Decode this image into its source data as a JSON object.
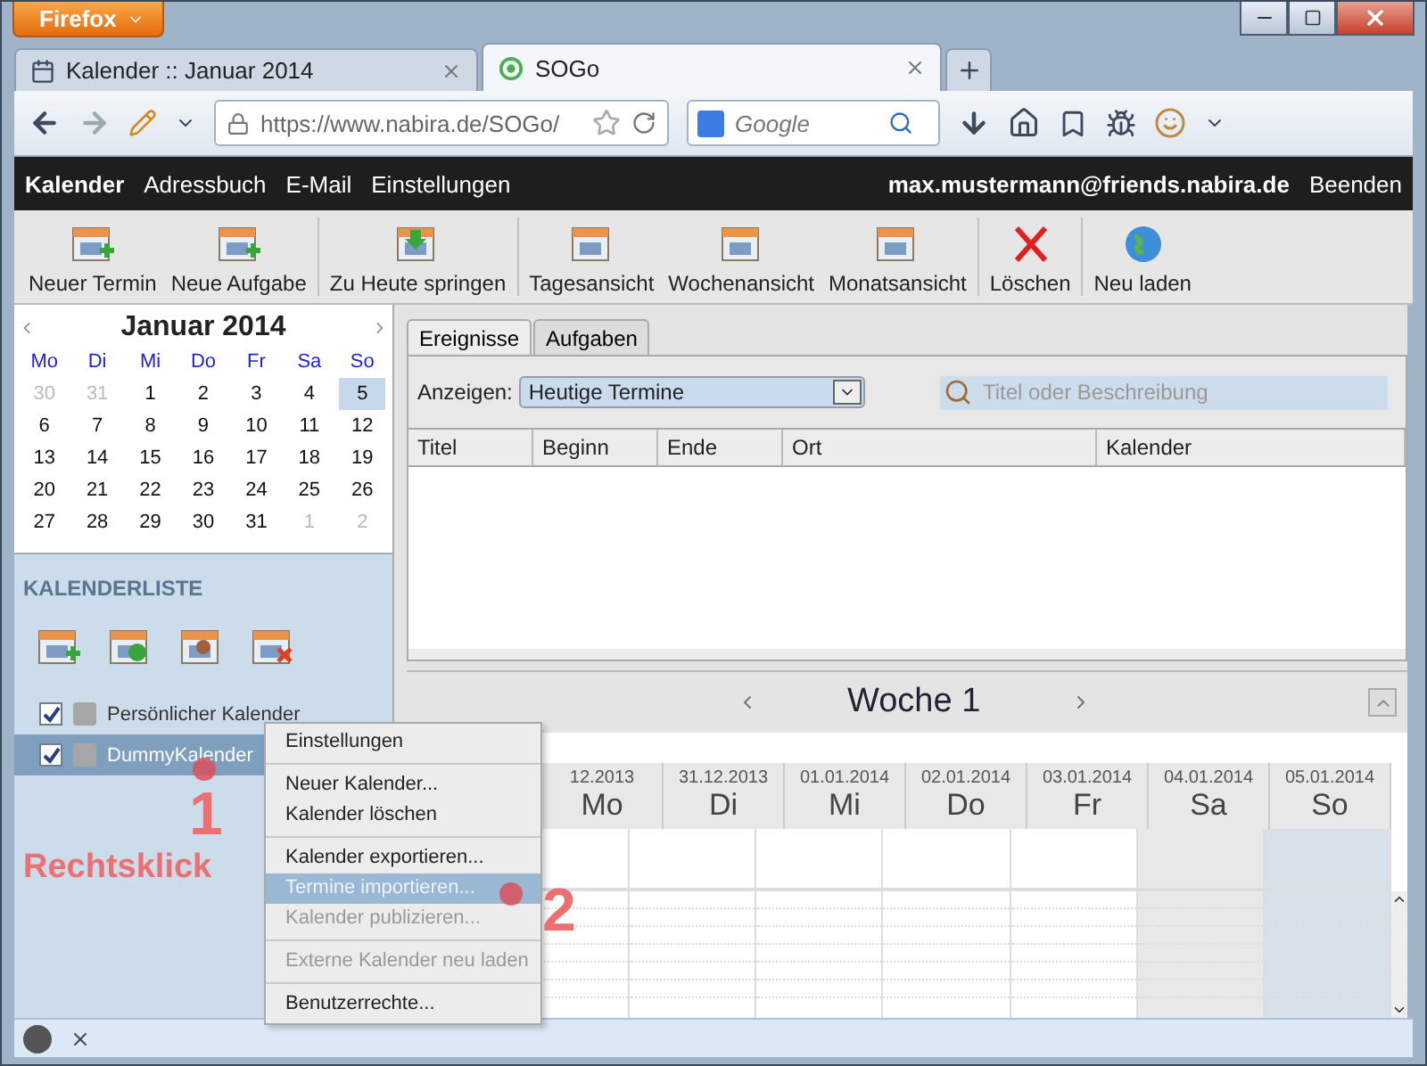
{
  "browser": {
    "menu_button": "Firefox",
    "tabs": [
      {
        "title": "Kalender :: Januar 2014",
        "selected": false
      },
      {
        "title": "SOGo",
        "selected": true
      }
    ],
    "url": "https://www.nabira.de/SOGo/",
    "search": {
      "placeholder": "Google"
    }
  },
  "app_nav": {
    "items": [
      {
        "label": "Kalender",
        "selected": true
      },
      {
        "label": "Adressbuch",
        "selected": false
      },
      {
        "label": "E-Mail",
        "selected": false
      },
      {
        "label": "Einstellungen",
        "selected": false
      }
    ],
    "user": "max.mustermann@friends.nabira.de",
    "logout": "Beenden"
  },
  "toolbar": [
    "Neuer Termin",
    "Neue Aufgabe",
    "Zu Heute springen",
    "Tagesansicht",
    "Wochenansicht",
    "Monatsansicht",
    "Löschen",
    "Neu laden"
  ],
  "mini_calendar": {
    "month": "Januar",
    "year": "2014",
    "weekdays": [
      "Mo",
      "Di",
      "Mi",
      "Do",
      "Fr",
      "Sa",
      "So"
    ],
    "days": [
      {
        "label": "30",
        "muted": true,
        "selected": false
      },
      {
        "label": "31",
        "muted": true,
        "selected": false
      },
      {
        "label": "1",
        "muted": false,
        "selected": false
      },
      {
        "label": "2",
        "muted": false,
        "selected": false
      },
      {
        "label": "3",
        "muted": false,
        "selected": false
      },
      {
        "label": "4",
        "muted": false,
        "selected": false
      },
      {
        "label": "5",
        "muted": false,
        "selected": true
      },
      {
        "label": "6",
        "muted": false,
        "selected": false
      },
      {
        "label": "7",
        "muted": false,
        "selected": false
      },
      {
        "label": "8",
        "muted": false,
        "selected": false
      },
      {
        "label": "9",
        "muted": false,
        "selected": false
      },
      {
        "label": "10",
        "muted": false,
        "selected": false
      },
      {
        "label": "11",
        "muted": false,
        "selected": false
      },
      {
        "label": "12",
        "muted": false,
        "selected": false
      },
      {
        "label": "13",
        "muted": false,
        "selected": false
      },
      {
        "label": "14",
        "muted": false,
        "selected": false
      },
      {
        "label": "15",
        "muted": false,
        "selected": false
      },
      {
        "label": "16",
        "muted": false,
        "selected": false
      },
      {
        "label": "17",
        "muted": false,
        "selected": false
      },
      {
        "label": "18",
        "muted": false,
        "selected": false
      },
      {
        "label": "19",
        "muted": false,
        "selected": false
      },
      {
        "label": "20",
        "muted": false,
        "selected": false
      },
      {
        "label": "21",
        "muted": false,
        "selected": false
      },
      {
        "label": "22",
        "muted": false,
        "selected": false
      },
      {
        "label": "23",
        "muted": false,
        "selected": false
      },
      {
        "label": "24",
        "muted": false,
        "selected": false
      },
      {
        "label": "25",
        "muted": false,
        "selected": false
      },
      {
        "label": "26",
        "muted": false,
        "selected": false
      },
      {
        "label": "27",
        "muted": false,
        "selected": false
      },
      {
        "label": "28",
        "muted": false,
        "selected": false
      },
      {
        "label": "29",
        "muted": false,
        "selected": false
      },
      {
        "label": "30",
        "muted": false,
        "selected": false
      },
      {
        "label": "31",
        "muted": false,
        "selected": false
      },
      {
        "label": "1",
        "muted": true,
        "selected": false
      },
      {
        "label": "2",
        "muted": true,
        "selected": false
      }
    ]
  },
  "calendar_list": {
    "heading": "KALENDERLISTE",
    "calendars": [
      {
        "name": "Persönlicher Kalender",
        "checked": true,
        "selected": false,
        "color": "#a6a6a6"
      },
      {
        "name": "DummyKalender",
        "checked": true,
        "selected": true,
        "color": "#a6a6a6"
      }
    ]
  },
  "events": {
    "tabs": [
      {
        "label": "Ereignisse",
        "selected": true
      },
      {
        "label": "Aufgaben",
        "selected": false
      }
    ],
    "filter_label": "Anzeigen:",
    "filter_value": "Heutige Termine",
    "search_placeholder": "Titel oder Beschreibung",
    "columns": [
      "Titel",
      "Beginn",
      "Ende",
      "Ort",
      "Kalender"
    ]
  },
  "week": {
    "title": "Woche 1",
    "days": [
      {
        "date": "12.2013",
        "name": "Mo",
        "kind": "weekday"
      },
      {
        "date": "31.12.2013",
        "name": "Di",
        "kind": "weekday"
      },
      {
        "date": "01.01.2014",
        "name": "Mi",
        "kind": "weekday"
      },
      {
        "date": "02.01.2014",
        "name": "Do",
        "kind": "weekday"
      },
      {
        "date": "03.01.2014",
        "name": "Fr",
        "kind": "weekday"
      },
      {
        "date": "04.01.2014",
        "name": "Sa",
        "kind": "weekend"
      },
      {
        "date": "05.01.2014",
        "name": "So",
        "kind": "today"
      }
    ]
  },
  "context_menu": [
    {
      "kind": "item",
      "label": "Einstellungen",
      "selected": false,
      "disabled": false
    },
    {
      "kind": "separator"
    },
    {
      "kind": "item",
      "label": "Neuer Kalender...",
      "selected": false,
      "disabled": false
    },
    {
      "kind": "item",
      "label": "Kalender löschen",
      "selected": false,
      "disabled": false
    },
    {
      "kind": "separator"
    },
    {
      "kind": "item",
      "label": "Kalender exportieren...",
      "selected": false,
      "disabled": false
    },
    {
      "kind": "item",
      "label": "Termine importieren...",
      "selected": true,
      "disabled": false
    },
    {
      "kind": "item",
      "label": "Kalender publizieren...",
      "selected": false,
      "disabled": true
    },
    {
      "kind": "separator"
    },
    {
      "kind": "item",
      "label": "Externe Kalender neu laden",
      "selected": false,
      "disabled": true
    },
    {
      "kind": "separator"
    },
    {
      "kind": "item",
      "label": "Benutzerrechte...",
      "selected": false,
      "disabled": false
    }
  ],
  "annotations": [
    "1",
    "Rechtsklick",
    "2"
  ]
}
